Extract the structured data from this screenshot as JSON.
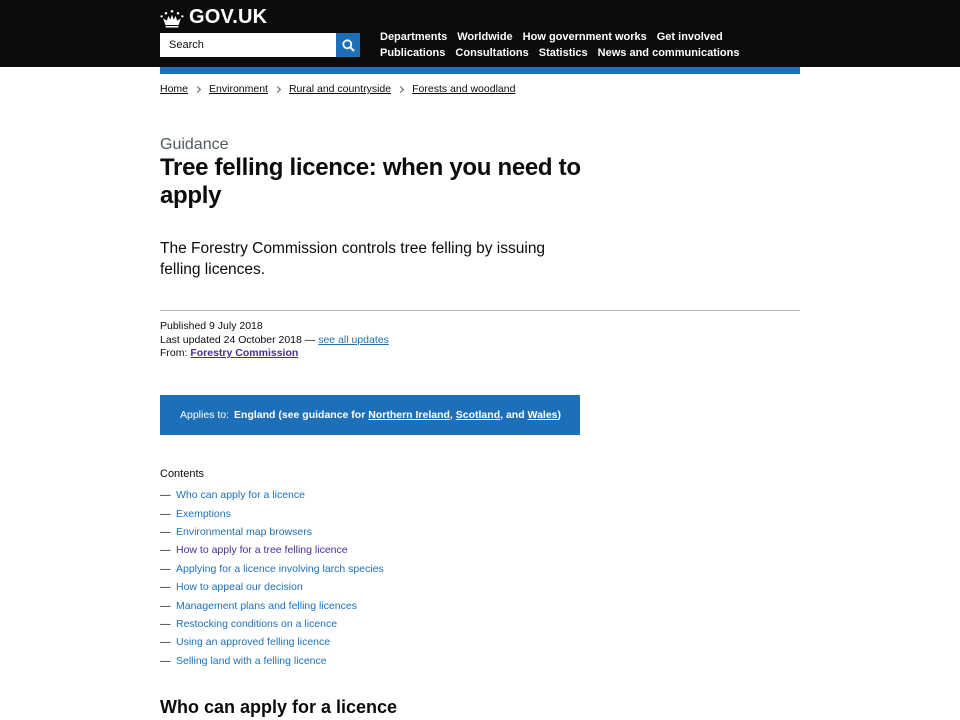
{
  "header": {
    "logo_text": "GOV.UK",
    "search_placeholder": "Search",
    "nav_row1": [
      "Departments",
      "Worldwide",
      "How government works",
      "Get involved"
    ],
    "nav_row2": [
      "Publications",
      "Consultations",
      "Statistics",
      "News and communications"
    ]
  },
  "breadcrumb": [
    "Home",
    "Environment",
    "Rural and countryside",
    "Forests and woodland"
  ],
  "page": {
    "caption": "Guidance",
    "title": "Tree felling licence: when you need to apply",
    "lead": "The Forestry Commission controls tree felling by issuing felling licences."
  },
  "meta": {
    "published": "Published 9 July 2018",
    "updated": "Last updated 24 October 2018 —",
    "see_updates": "see all updates",
    "from_label": "From:",
    "from_org": "Forestry Commission"
  },
  "applies": {
    "label": "Applies to:",
    "prefix": "England (see guidance for",
    "link1": "Northern Ireland",
    "comma": ",",
    "link2": "Scotland",
    "and": ", and",
    "link3": "Wales",
    "suffix": ")"
  },
  "contents": {
    "title": "Contents",
    "dash": "—",
    "items": [
      "Who can apply for a licence",
      "Exemptions",
      "Environmental map browsers",
      "How to apply for a tree felling licence",
      "Applying for a licence involving larch species",
      "How to appeal our decision",
      "Management plans and felling licences",
      "Restocking conditions on a licence",
      "Using an approved felling licence",
      "Selling land with a felling licence"
    ]
  },
  "section_heading": "Who can apply for a licence",
  "colors": {
    "header_bg": "#0b0c0c",
    "brand_blue": "#1d70b8",
    "link": "#1d70b8",
    "visited_link": "#4c2c92",
    "secondary_text": "#505a5f"
  }
}
